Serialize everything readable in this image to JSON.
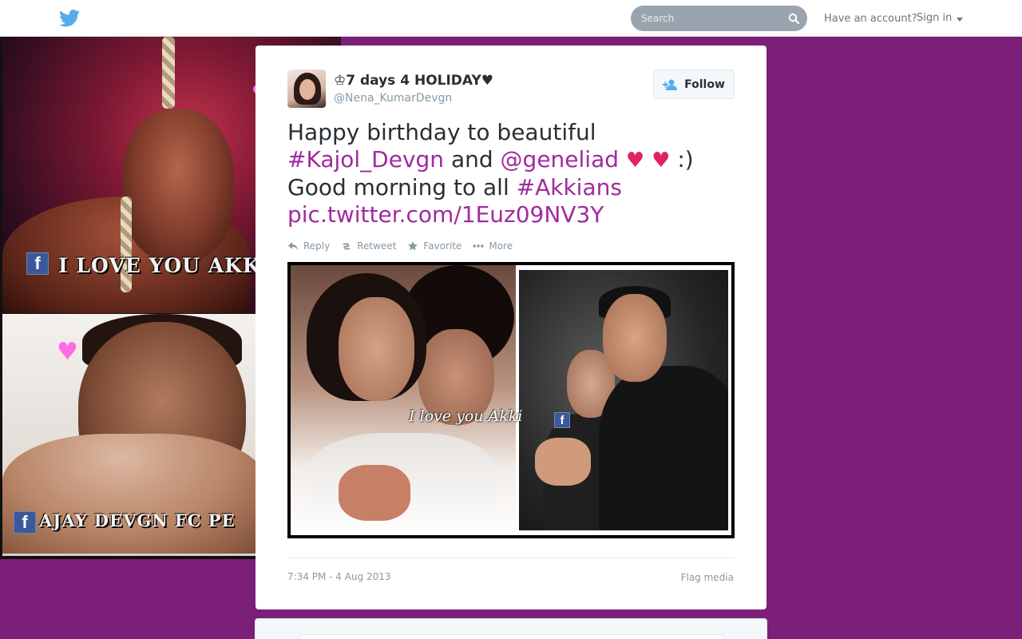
{
  "topbar": {
    "search_placeholder": "Search",
    "have_account": "Have an account?",
    "sign_in": "Sign in",
    "bird_icon": "twitter-bird-icon",
    "brand_color": "#55acee"
  },
  "background": {
    "caption_top": "I LOVE YOU AKKI",
    "caption_bottom": "AJAY DEVGN FC PE",
    "fb_letter": "f",
    "heart": "♥",
    "page_bg_color": "#7b1f78"
  },
  "tweet": {
    "display_name": "♔7 days 4 HOLIDAY♥",
    "handle": "@Nena_KumarDevgn",
    "follow_label": "Follow",
    "text": {
      "part1": "Happy birthday to beautiful ",
      "hashtag1": "#Kajol_Devgn",
      "part2": " and ",
      "mention": "@geneliad",
      "heart": "♥",
      "part3": " :)",
      "part4": "Good morning to all ",
      "hashtag2": "#Akkians",
      "pic_link": "pic.twitter.com/1Euz09NV3Y"
    },
    "actions": {
      "reply": "Reply",
      "retweet": "Retweet",
      "favorite": "Favorite",
      "more": "More"
    },
    "media_caption": "I love you Akki",
    "timestamp": "7:34 PM - 4 Aug 2013",
    "flag_media": "Flag media",
    "link_color": "#a12a9e"
  }
}
